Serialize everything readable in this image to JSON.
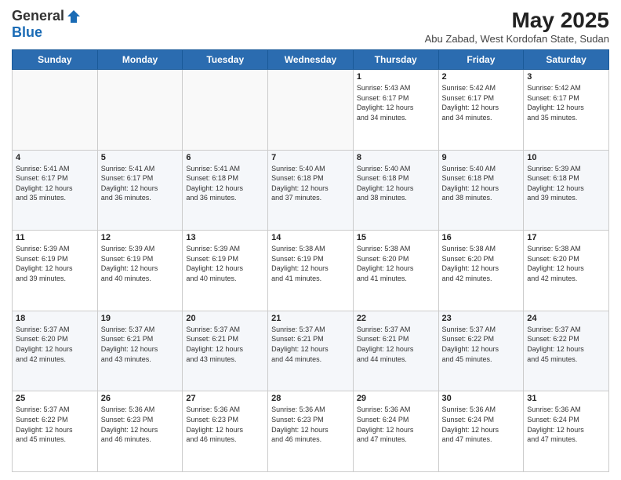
{
  "header": {
    "logo_general": "General",
    "logo_blue": "Blue",
    "month_title": "May 2025",
    "location": "Abu Zabad, West Kordofan State, Sudan"
  },
  "weekdays": [
    "Sunday",
    "Monday",
    "Tuesday",
    "Wednesday",
    "Thursday",
    "Friday",
    "Saturday"
  ],
  "weeks": [
    [
      {
        "day": "",
        "info": ""
      },
      {
        "day": "",
        "info": ""
      },
      {
        "day": "",
        "info": ""
      },
      {
        "day": "",
        "info": ""
      },
      {
        "day": "1",
        "info": "Sunrise: 5:43 AM\nSunset: 6:17 PM\nDaylight: 12 hours\nand 34 minutes."
      },
      {
        "day": "2",
        "info": "Sunrise: 5:42 AM\nSunset: 6:17 PM\nDaylight: 12 hours\nand 34 minutes."
      },
      {
        "day": "3",
        "info": "Sunrise: 5:42 AM\nSunset: 6:17 PM\nDaylight: 12 hours\nand 35 minutes."
      }
    ],
    [
      {
        "day": "4",
        "info": "Sunrise: 5:41 AM\nSunset: 6:17 PM\nDaylight: 12 hours\nand 35 minutes."
      },
      {
        "day": "5",
        "info": "Sunrise: 5:41 AM\nSunset: 6:17 PM\nDaylight: 12 hours\nand 36 minutes."
      },
      {
        "day": "6",
        "info": "Sunrise: 5:41 AM\nSunset: 6:18 PM\nDaylight: 12 hours\nand 36 minutes."
      },
      {
        "day": "7",
        "info": "Sunrise: 5:40 AM\nSunset: 6:18 PM\nDaylight: 12 hours\nand 37 minutes."
      },
      {
        "day": "8",
        "info": "Sunrise: 5:40 AM\nSunset: 6:18 PM\nDaylight: 12 hours\nand 38 minutes."
      },
      {
        "day": "9",
        "info": "Sunrise: 5:40 AM\nSunset: 6:18 PM\nDaylight: 12 hours\nand 38 minutes."
      },
      {
        "day": "10",
        "info": "Sunrise: 5:39 AM\nSunset: 6:18 PM\nDaylight: 12 hours\nand 39 minutes."
      }
    ],
    [
      {
        "day": "11",
        "info": "Sunrise: 5:39 AM\nSunset: 6:19 PM\nDaylight: 12 hours\nand 39 minutes."
      },
      {
        "day": "12",
        "info": "Sunrise: 5:39 AM\nSunset: 6:19 PM\nDaylight: 12 hours\nand 40 minutes."
      },
      {
        "day": "13",
        "info": "Sunrise: 5:39 AM\nSunset: 6:19 PM\nDaylight: 12 hours\nand 40 minutes."
      },
      {
        "day": "14",
        "info": "Sunrise: 5:38 AM\nSunset: 6:19 PM\nDaylight: 12 hours\nand 41 minutes."
      },
      {
        "day": "15",
        "info": "Sunrise: 5:38 AM\nSunset: 6:20 PM\nDaylight: 12 hours\nand 41 minutes."
      },
      {
        "day": "16",
        "info": "Sunrise: 5:38 AM\nSunset: 6:20 PM\nDaylight: 12 hours\nand 42 minutes."
      },
      {
        "day": "17",
        "info": "Sunrise: 5:38 AM\nSunset: 6:20 PM\nDaylight: 12 hours\nand 42 minutes."
      }
    ],
    [
      {
        "day": "18",
        "info": "Sunrise: 5:37 AM\nSunset: 6:20 PM\nDaylight: 12 hours\nand 42 minutes."
      },
      {
        "day": "19",
        "info": "Sunrise: 5:37 AM\nSunset: 6:21 PM\nDaylight: 12 hours\nand 43 minutes."
      },
      {
        "day": "20",
        "info": "Sunrise: 5:37 AM\nSunset: 6:21 PM\nDaylight: 12 hours\nand 43 minutes."
      },
      {
        "day": "21",
        "info": "Sunrise: 5:37 AM\nSunset: 6:21 PM\nDaylight: 12 hours\nand 44 minutes."
      },
      {
        "day": "22",
        "info": "Sunrise: 5:37 AM\nSunset: 6:21 PM\nDaylight: 12 hours\nand 44 minutes."
      },
      {
        "day": "23",
        "info": "Sunrise: 5:37 AM\nSunset: 6:22 PM\nDaylight: 12 hours\nand 45 minutes."
      },
      {
        "day": "24",
        "info": "Sunrise: 5:37 AM\nSunset: 6:22 PM\nDaylight: 12 hours\nand 45 minutes."
      }
    ],
    [
      {
        "day": "25",
        "info": "Sunrise: 5:37 AM\nSunset: 6:22 PM\nDaylight: 12 hours\nand 45 minutes."
      },
      {
        "day": "26",
        "info": "Sunrise: 5:36 AM\nSunset: 6:23 PM\nDaylight: 12 hours\nand 46 minutes."
      },
      {
        "day": "27",
        "info": "Sunrise: 5:36 AM\nSunset: 6:23 PM\nDaylight: 12 hours\nand 46 minutes."
      },
      {
        "day": "28",
        "info": "Sunrise: 5:36 AM\nSunset: 6:23 PM\nDaylight: 12 hours\nand 46 minutes."
      },
      {
        "day": "29",
        "info": "Sunrise: 5:36 AM\nSunset: 6:24 PM\nDaylight: 12 hours\nand 47 minutes."
      },
      {
        "day": "30",
        "info": "Sunrise: 5:36 AM\nSunset: 6:24 PM\nDaylight: 12 hours\nand 47 minutes."
      },
      {
        "day": "31",
        "info": "Sunrise: 5:36 AM\nSunset: 6:24 PM\nDaylight: 12 hours\nand 47 minutes."
      }
    ]
  ]
}
